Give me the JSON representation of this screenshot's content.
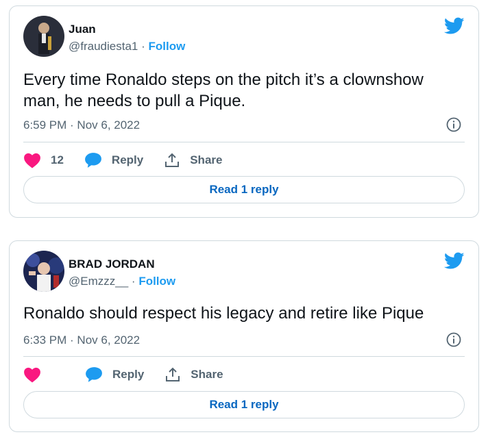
{
  "tweets": [
    {
      "name": "Juan",
      "handle": "@fraudiesta1",
      "separator": "·",
      "follow_label": "Follow",
      "text": "Every time Ronaldo steps on the pitch it’s a clownshow man, he needs to pull a Pique.",
      "time": "6:59 PM · Nov 6, 2022",
      "likes": "12",
      "reply_label": "Reply",
      "share_label": "Share",
      "read_replies_label": "Read 1 reply"
    },
    {
      "name": "BRAD JORDAN",
      "handle": "@Emzzz__",
      "separator": "·",
      "follow_label": "Follow",
      "text": "Ronaldo should respect his legacy and retire like Pique",
      "time": "6:33 PM · Nov 6, 2022",
      "likes": "",
      "reply_label": "Reply",
      "share_label": "Share",
      "read_replies_label": "Read 1 reply"
    }
  ],
  "colors": {
    "twitter_blue": "#1d9bf0",
    "like_pink": "#f91880",
    "link_blue": "#0867c0",
    "secondary_text": "#536471",
    "border": "#cfd9de"
  },
  "icons": [
    "twitter-bird-icon",
    "info-icon",
    "heart-icon",
    "reply-bubble-icon",
    "share-icon"
  ]
}
